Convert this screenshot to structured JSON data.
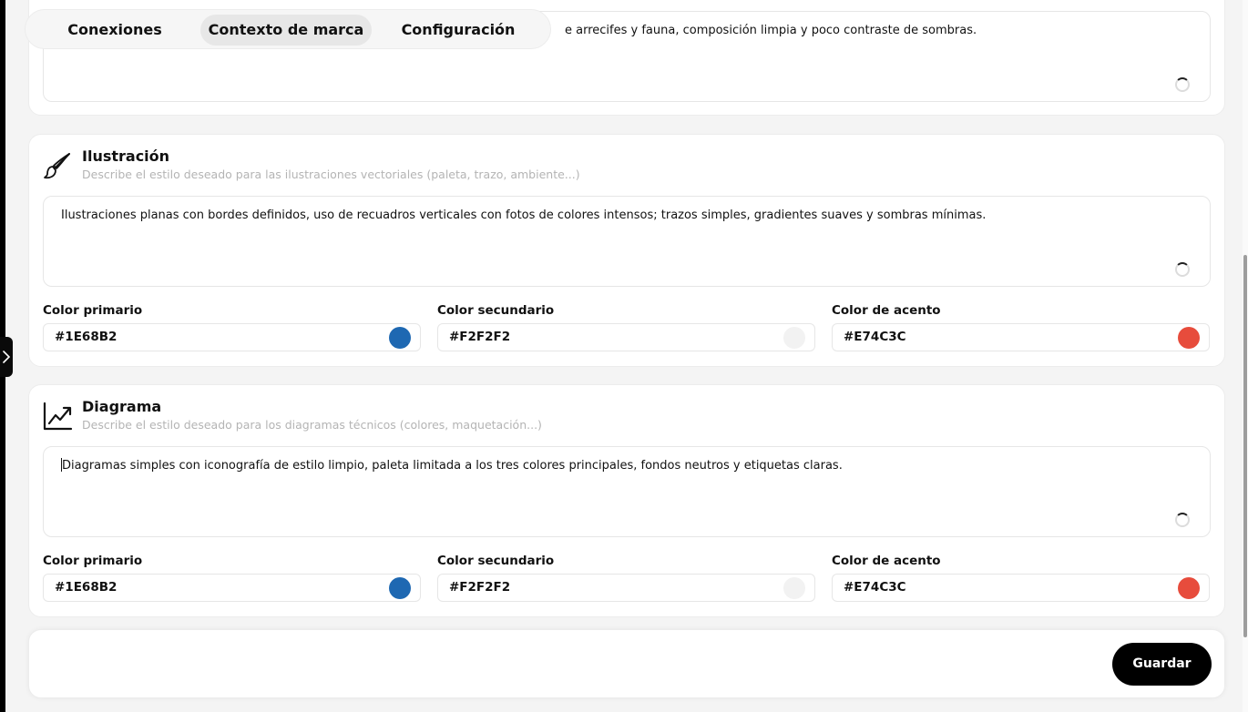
{
  "tabs": {
    "connections": "Conexiones",
    "brand_context": "Contexto de marca",
    "settings": "Configuración",
    "active": "brand_context"
  },
  "photo_section": {
    "text_visible": "e arrecifes y fauna, composición limpia y poco contraste de sombras."
  },
  "illustration": {
    "icon": "paintbrush-icon",
    "title": "Ilustración",
    "description": "Describe el estilo deseado para las ilustraciones vectoriales (paleta, trazo, ambiente...)",
    "text": "Ilustraciones planas con bordes definidos, uso de recuadros verticales con fotos de colores intensos; trazos simples, gradientes suaves y sombras mínimas.",
    "colors": [
      {
        "label": "Color primario",
        "value": "#1E68B2",
        "swatch": "#1E68B2"
      },
      {
        "label": "Color secundario",
        "value": "#F2F2F2",
        "swatch": "#F2F2F2"
      },
      {
        "label": "Color de acento",
        "value": "#E74C3C",
        "swatch": "#E74C3C"
      }
    ]
  },
  "diagram": {
    "icon": "trending-chart-icon",
    "title": "Diagrama",
    "description": "Describe el estilo deseado para los diagramas técnicos (colores, maquetación...)",
    "text": "Diagramas simples con iconografía de estilo limpio, paleta limitada a los tres colores principales, fondos neutros y etiquetas claras.",
    "colors": [
      {
        "label": "Color primario",
        "value": "#1E68B2",
        "swatch": "#1E68B2"
      },
      {
        "label": "Color secundario",
        "value": "#F2F2F2",
        "swatch": "#F2F2F2"
      },
      {
        "label": "Color de acento",
        "value": "#E74C3C",
        "swatch": "#E74C3C"
      }
    ]
  },
  "footer": {
    "save_label": "Guardar"
  }
}
